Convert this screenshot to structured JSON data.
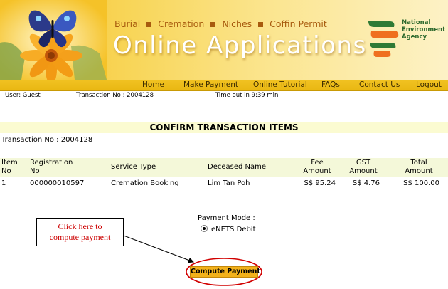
{
  "banner": {
    "categories": [
      "Burial",
      "Cremation",
      "Niches",
      "Coffin Permit"
    ],
    "title": "Online Applications",
    "agency_name": [
      "National",
      "Environment",
      "Agency"
    ]
  },
  "nav": [
    "Home",
    "Make Payment",
    "Online Tutorial",
    "FAQs",
    "Contact Us",
    "Logout"
  ],
  "info": {
    "user": "User: Guest",
    "transaction": "Transaction No : 2004128",
    "timeout": "Time out in 9:39 min"
  },
  "section_title": "CONFIRM TRANSACTION ITEMS",
  "transaction_line": "Transaction No : 2004128",
  "table": {
    "headers": {
      "item_no": [
        "Item",
        "No"
      ],
      "registration_no": [
        "Registration",
        "No"
      ],
      "service_type": "Service Type",
      "deceased_name": "Deceased Name",
      "fee_amount": [
        "Fee",
        "Amount"
      ],
      "gst_amount": [
        "GST",
        "Amount"
      ],
      "total_amount": [
        "Total",
        "Amount"
      ]
    },
    "rows": [
      {
        "item_no": "1",
        "registration_no": "000000010597",
        "service_type": "Cremation Booking",
        "deceased_name": "Lim Tan Poh",
        "fee_amount": "S$ 95.24",
        "gst_amount": "S$ 4.76",
        "total_amount": "S$ 100.00"
      }
    ]
  },
  "payment": {
    "label": "Payment Mode :",
    "option": "eNETS Debit",
    "selected": true
  },
  "callout": [
    "Click here to",
    "compute payment"
  ],
  "compute_button": "Compute Payment",
  "colors": {
    "banner_yellow": "#f5c228",
    "nav_bar": "#eebd1a",
    "table_header": "#f4f8d9",
    "section_bar": "#fbfbd1",
    "button_orange": "#f2b11b",
    "highlight_ring": "#d10000",
    "callout_text": "#cc0000",
    "category_text": "#a85b0e"
  },
  "icons": {
    "banner_art": "butterfly-on-flower",
    "logo": "nea-logo"
  }
}
